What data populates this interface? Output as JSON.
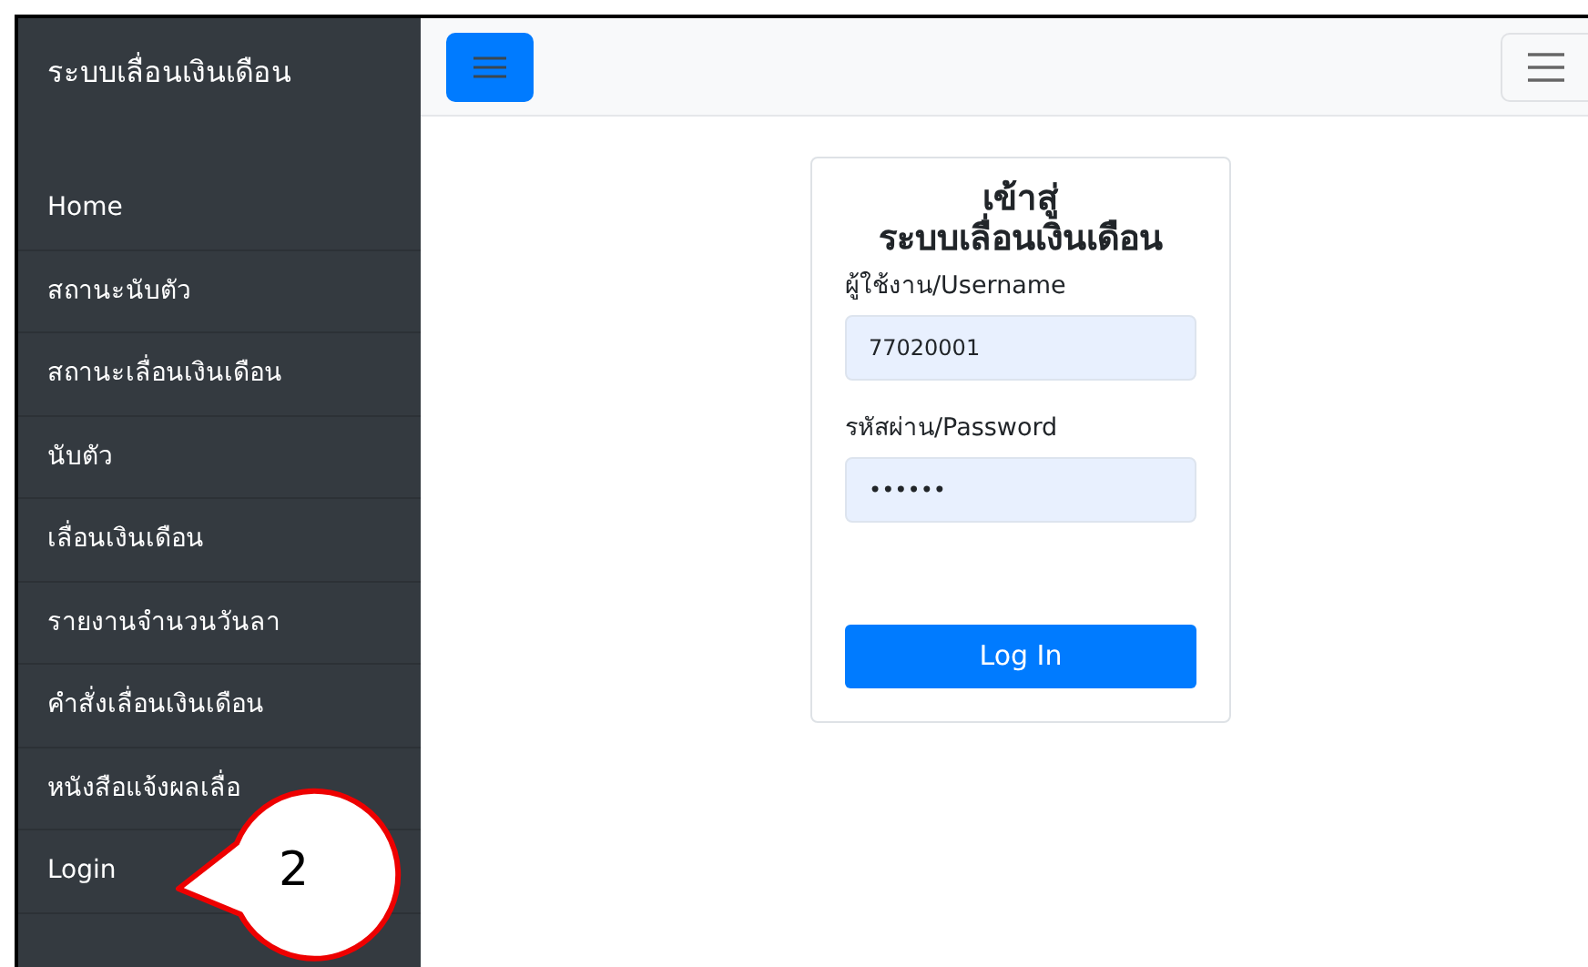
{
  "sidebar": {
    "title": "ระบบเลื่อนเงินเดือน",
    "items": [
      {
        "label": "Home"
      },
      {
        "label": "สถานะนับตัว"
      },
      {
        "label": "สถานะเลื่อนเงินเดือน"
      },
      {
        "label": "นับตัว"
      },
      {
        "label": "เลื่อนเงินเดือน"
      },
      {
        "label": "รายงานจำนวนวันลา"
      },
      {
        "label": "คำสั่งเลื่อนเงินเดือน"
      },
      {
        "label": "หนังสือแจ้งผลเลื่อ"
      },
      {
        "label": "Login"
      }
    ]
  },
  "login": {
    "title_line_1": "เข้าสู่",
    "title_line_2": "ระบบเลื่อนเงินเดือน",
    "username_label": "ผู้ใช้งาน/Username",
    "username_value": "77020001",
    "password_label": "รหัสผ่าน/Password",
    "password_value": "••••••",
    "button": "Log In"
  },
  "callout": {
    "label": "2"
  }
}
